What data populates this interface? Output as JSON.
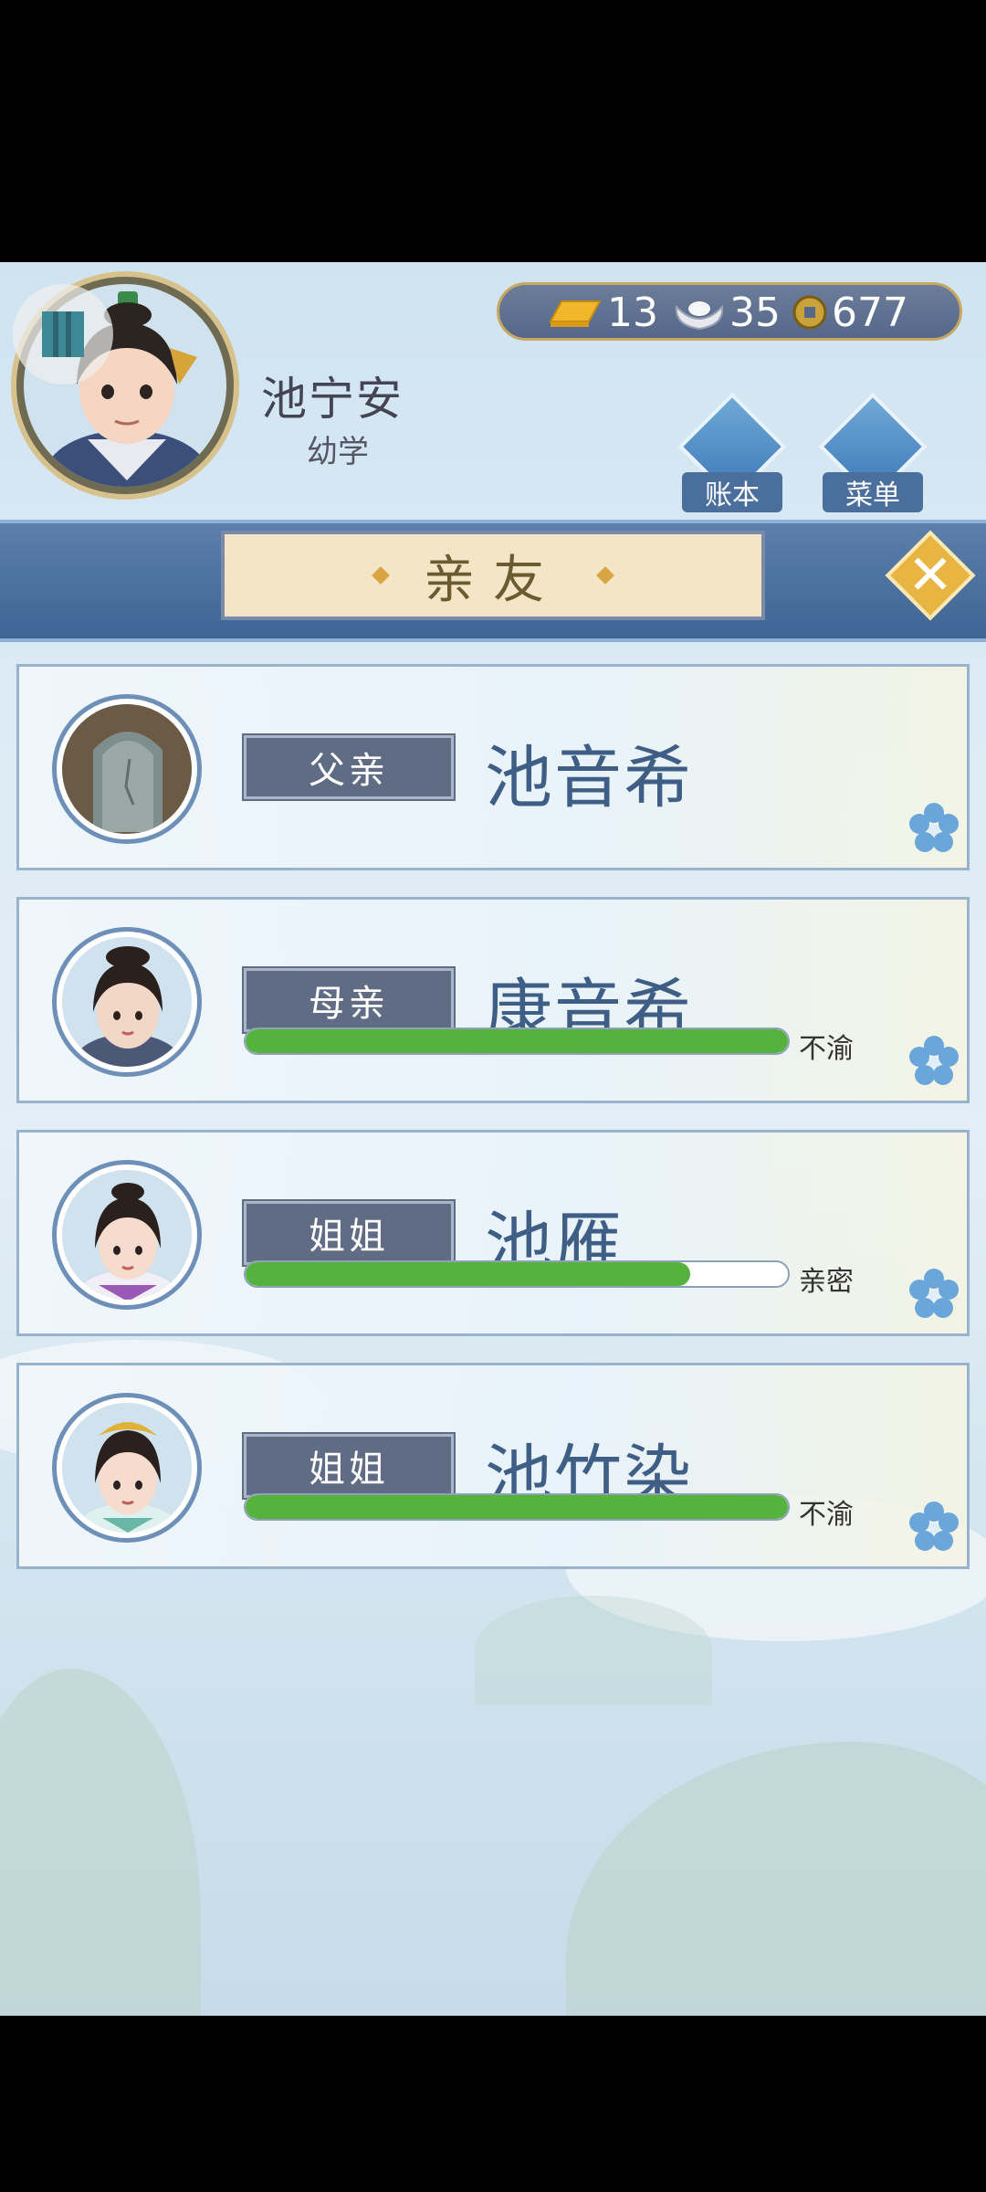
{
  "player": {
    "name": "池宁安",
    "rank": "幼学"
  },
  "resources": {
    "gold": "13",
    "silver": "35",
    "coins": "677"
  },
  "header_buttons": {
    "ledger": "账本",
    "menu": "菜单"
  },
  "title": "亲友",
  "relatives": [
    {
      "role": "父亲",
      "name": "池音希",
      "relation": "",
      "level": 0
    },
    {
      "role": "母亲",
      "name": "康音希",
      "relation": "不渝",
      "level": 1.0
    },
    {
      "role": "姐姐",
      "name": "池雁",
      "relation": "亲密",
      "level": 0.82
    },
    {
      "role": "姐姐",
      "name": "池竹染",
      "relation": "不渝",
      "level": 1.0
    }
  ],
  "colors": {
    "bar_fill": "#55b33d",
    "name_text": "#3f5e86",
    "banner": "#4a6e9d"
  }
}
